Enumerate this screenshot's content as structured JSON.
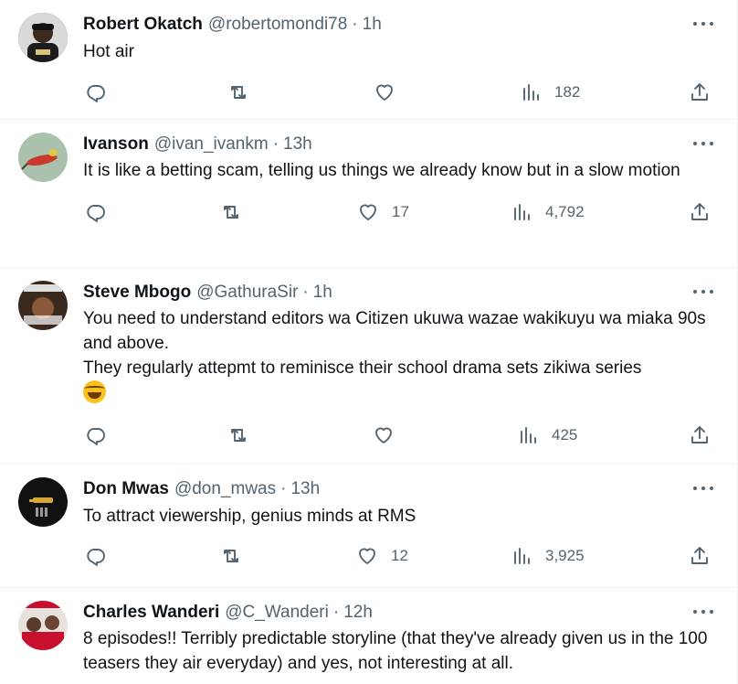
{
  "tweets": [
    {
      "name": "Robert Okatch",
      "handle": "@robertomondi78",
      "time": "1h",
      "text": "Hot air",
      "likes": "",
      "views": "182",
      "avatar_colors": [
        "#2b2b2b",
        "#d8c27a"
      ]
    },
    {
      "name": "Ivanson",
      "handle": "@ivan_ivankm",
      "time": "13h",
      "text": "It is like a betting scam, telling us things we already know but in a slow motion",
      "likes": "17",
      "views": "4,792",
      "avatar_colors": [
        "#9bb3a0",
        "#c7392b"
      ]
    },
    {
      "name": "Steve Mbogo",
      "handle": "@GathuraSir",
      "time": "1h",
      "text": "You need to understand editors wa Citizen ukuwa wazae wakikuyu wa miaka 90s and above.\nThey regularly attepmt to reminisce their school drama sets zikiwa series",
      "emoji": "face-with-tears-of-joy",
      "likes": "",
      "views": "425",
      "avatar_colors": [
        "#3a2a1e",
        "#b08a5a"
      ]
    },
    {
      "name": "Don Mwas",
      "handle": "@don_mwas",
      "time": "13h",
      "text": "To attract viewership, genius minds at RMS",
      "likes": "12",
      "views": "3,925",
      "avatar_colors": [
        "#111111",
        "#d4a73a"
      ]
    },
    {
      "name": "Charles Wanderi",
      "handle": "@C_Wanderi",
      "time": "12h",
      "text": "8 episodes!! Terribly predictable storyline (that they've already given us in the 100 teasers they air everyday) and yes, not interesting at all.",
      "likes": "",
      "views": "",
      "avatar_colors": [
        "#c8102e",
        "#5a3a2a"
      ]
    }
  ],
  "icons": {
    "reply": "reply-icon",
    "retweet": "retweet-icon",
    "like": "heart-icon",
    "views": "views-icon",
    "share": "share-icon",
    "more": "more-icon"
  },
  "colors": {
    "text": "#0f1419",
    "secondary": "#536471",
    "divider": "#eff3f4"
  }
}
